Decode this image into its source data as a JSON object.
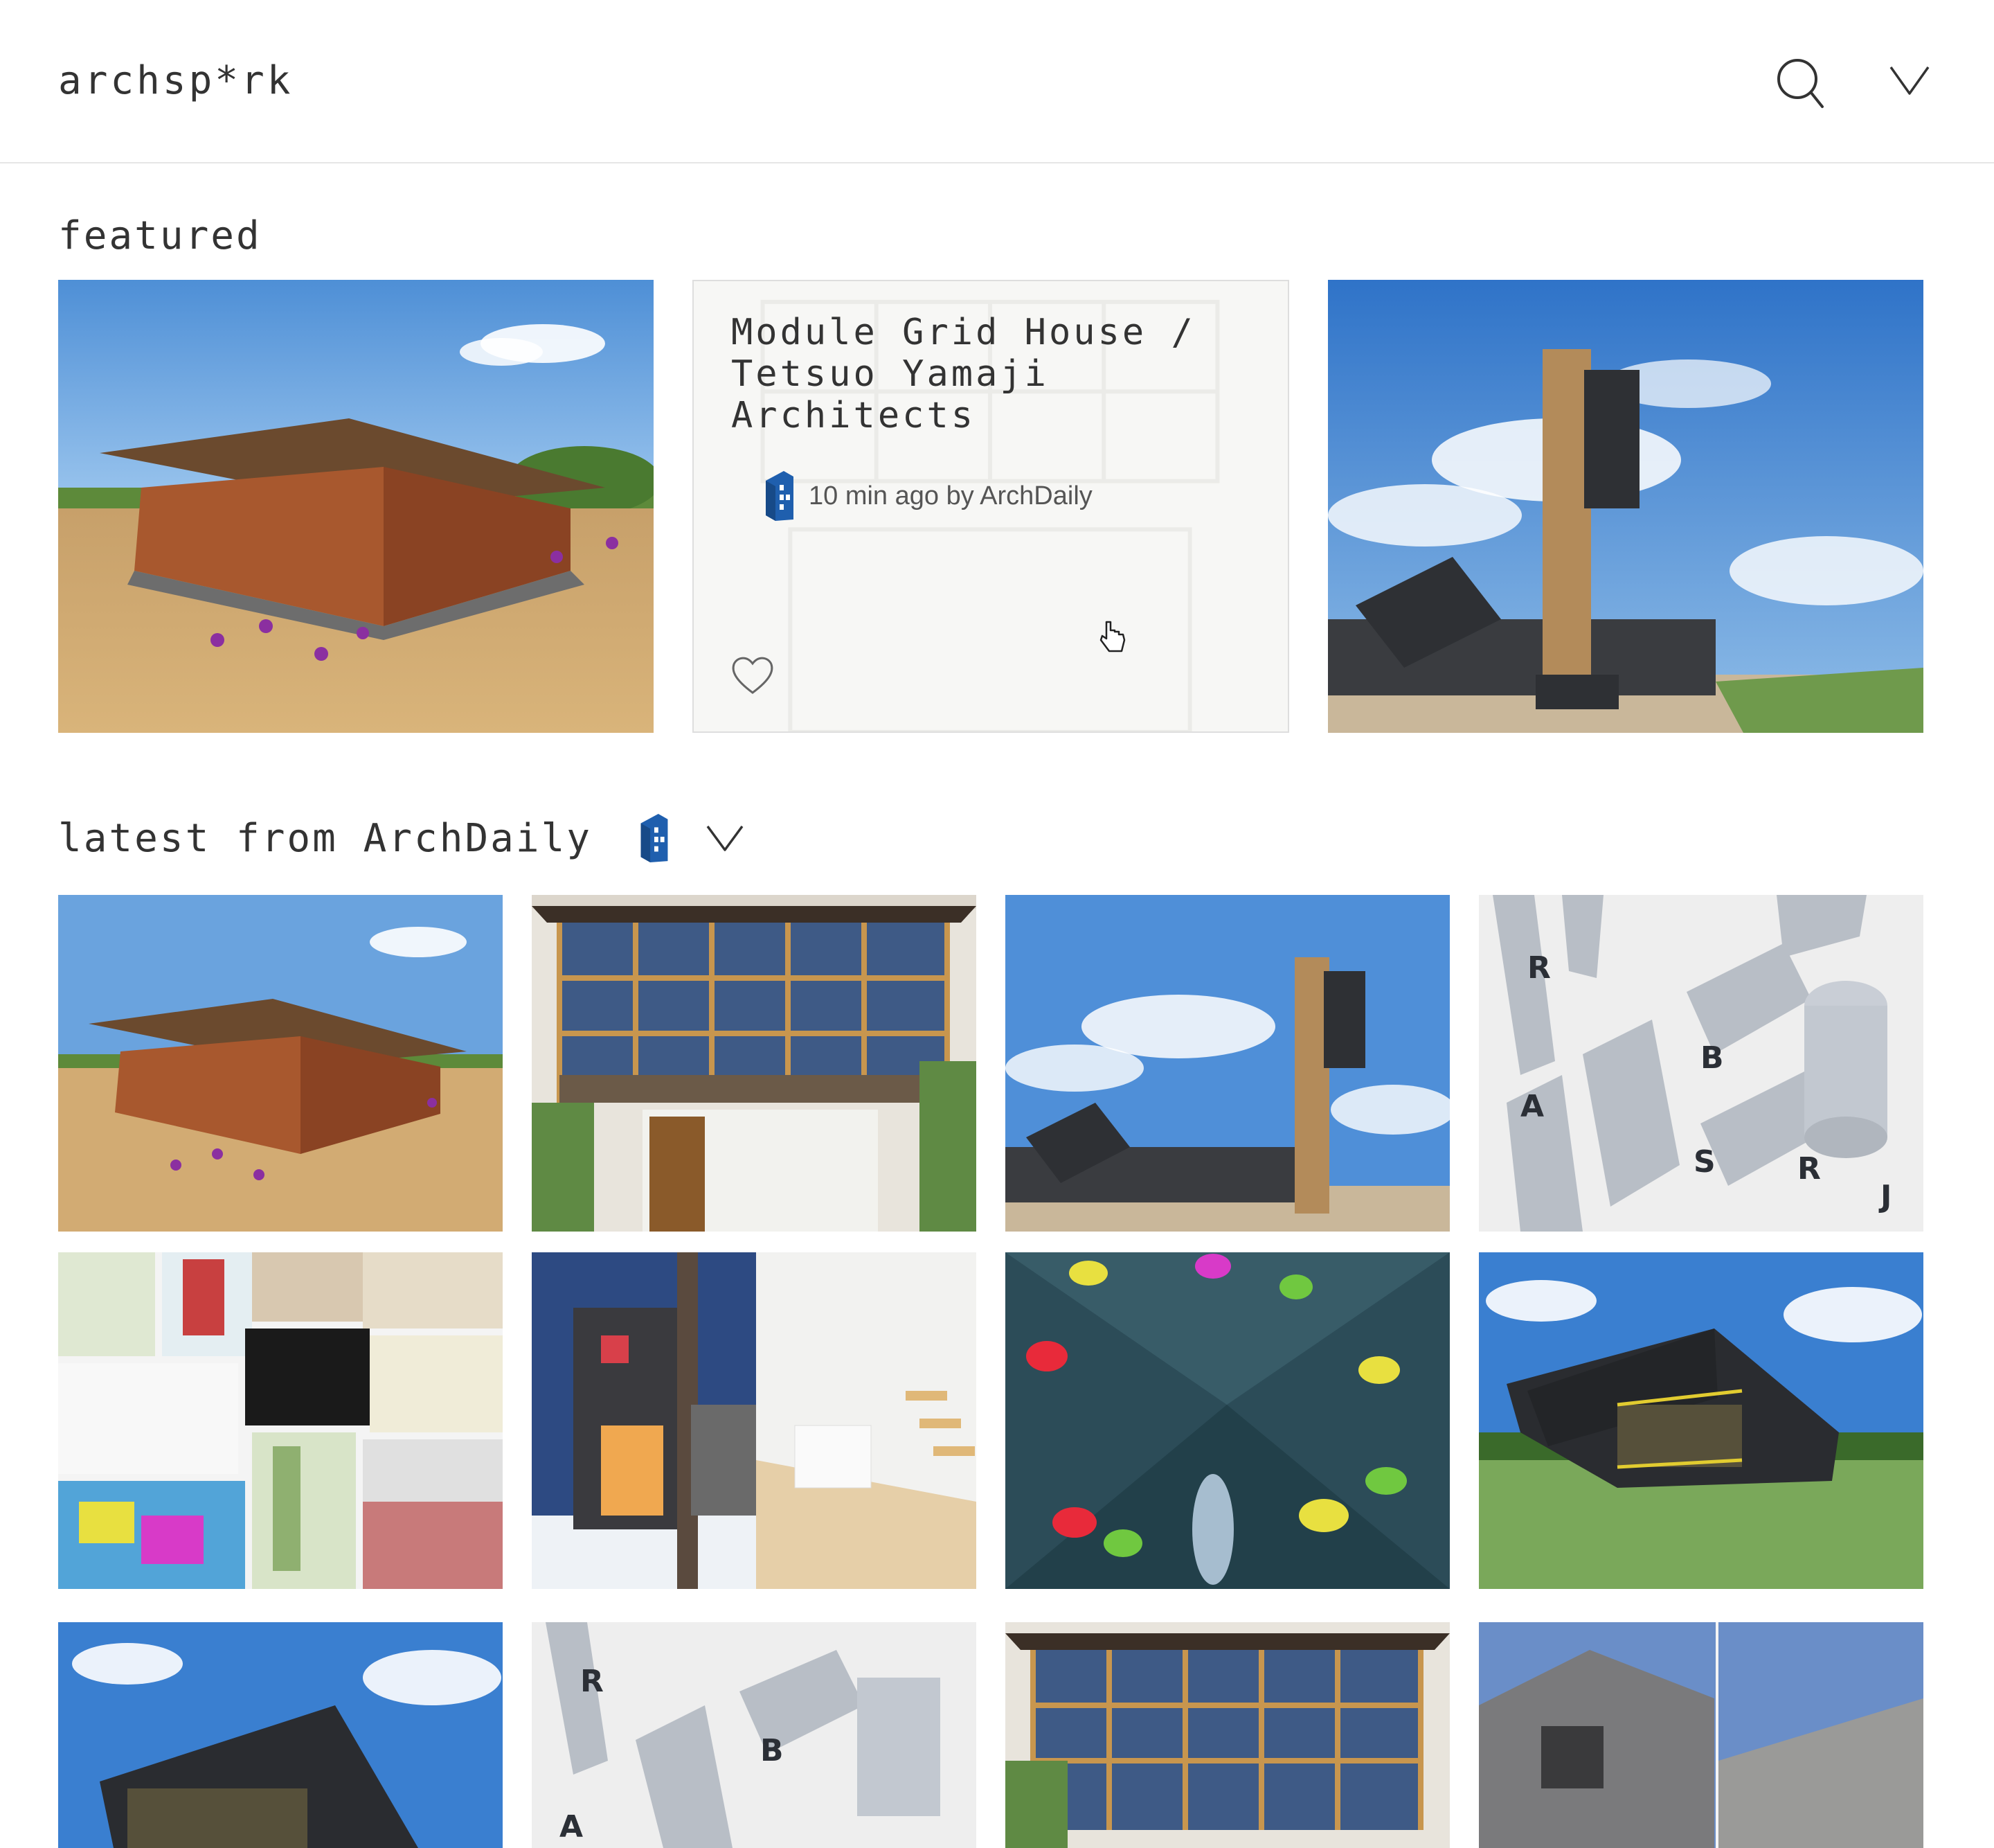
{
  "header": {
    "logo": "archsp*rk",
    "search_icon": "search-icon",
    "menu_icon": "chevron-down-icon"
  },
  "featured": {
    "title": "featured",
    "card": {
      "title": "Module Grid House / Tetsuo Yamaji Architects",
      "meta": "10 min ago by ArchDaily",
      "heart_icon": "heart-icon"
    }
  },
  "latest": {
    "title": "latest from ArchDaily",
    "source_icon": "archdaily-logo-icon",
    "dropdown_icon": "chevron-down-icon"
  },
  "colors": {
    "accent_blue": "#1f5fae",
    "border": "#e6e6e6",
    "text": "#333333"
  }
}
